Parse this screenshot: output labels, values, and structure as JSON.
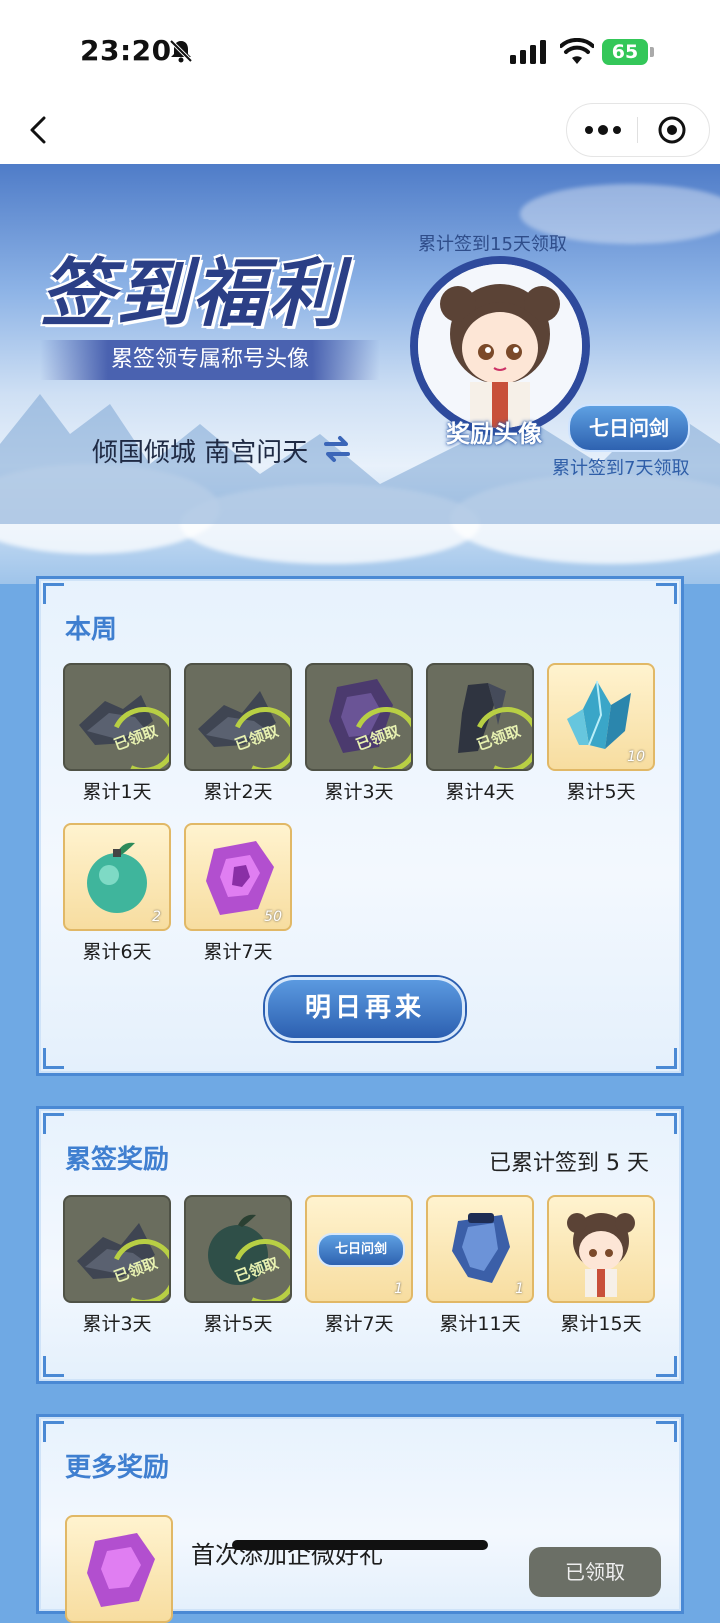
{
  "status_bar": {
    "time": "23:20",
    "battery": "65"
  },
  "banner": {
    "title": "签到福利",
    "subtitle": "累签领专属称号头像",
    "avatar_caption_top": "累计签到15天领取",
    "reward_avatar_label": "奖励头像",
    "title_badge": "七日问剑",
    "avatar_caption_bottom": "累计签到7天领取",
    "player_name": "倾国倾城 南宫问天"
  },
  "week_card": {
    "title": "本周",
    "items": [
      {
        "label": "累计1天",
        "claimed": true,
        "stamp": "已领取",
        "icon": "debris-icon"
      },
      {
        "label": "累计2天",
        "claimed": true,
        "stamp": "已领取",
        "icon": "debris-icon"
      },
      {
        "label": "累计3天",
        "claimed": true,
        "stamp": "已领取",
        "icon": "purple-crystal-icon"
      },
      {
        "label": "累计4天",
        "claimed": true,
        "stamp": "已领取",
        "icon": "dark-stone-icon"
      },
      {
        "label": "累计5天",
        "claimed": false,
        "qty": "10",
        "icon": "blue-crystal-icon"
      },
      {
        "label": "累计6天",
        "claimed": false,
        "qty": "2",
        "icon": "green-orb-icon"
      },
      {
        "label": "累计7天",
        "claimed": false,
        "qty": "50",
        "icon": "purple-crystal-icon"
      }
    ],
    "button": "明日再来"
  },
  "cumulative_card": {
    "title": "累签奖励",
    "progress_text": "已累计签到 5 天",
    "items": [
      {
        "label": "累计3天",
        "claimed": true,
        "stamp": "已领取",
        "icon": "debris-icon"
      },
      {
        "label": "累计5天",
        "claimed": true,
        "stamp": "已领取",
        "icon": "green-orb-icon"
      },
      {
        "label": "累计7天",
        "claimed": false,
        "qty": "1",
        "badge": "七日问剑",
        "icon": "title-badge-icon"
      },
      {
        "label": "累计11天",
        "claimed": false,
        "qty": "1",
        "icon": "cloak-icon"
      },
      {
        "label": "累计15天",
        "claimed": false,
        "icon": "avatar-frame-icon"
      }
    ]
  },
  "more_card": {
    "title": "更多奖励",
    "first_item_text": "首次添加企微好礼",
    "first_item_button": "已领取"
  }
}
